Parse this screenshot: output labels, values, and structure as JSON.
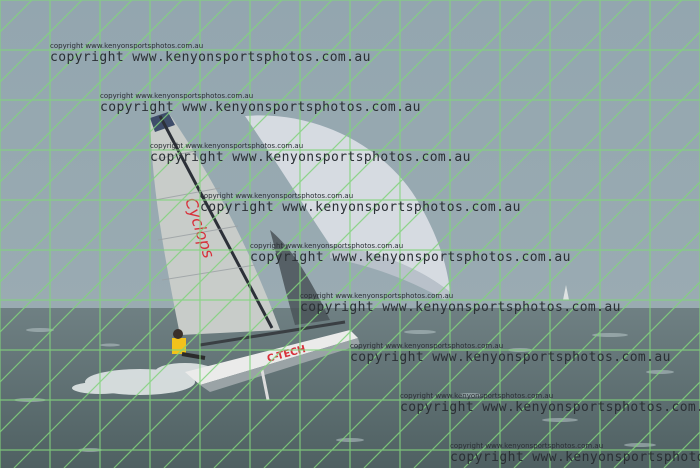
{
  "photo": {
    "subject": "Moth foiling dinghy with spinnaker on choppy water",
    "colors": {
      "sky": "#8fa3ac",
      "sea": "#5d6f72",
      "grid": "#7fd07a",
      "sail_main": "#c9ccc8",
      "spinnaker": "#d9dde3",
      "hull": "#e8e8e6",
      "hull_text": "#d8303a",
      "watermark": "#2a2f33"
    },
    "hull_label": "C-TECH",
    "sail_label": "Cyclops",
    "watermark": {
      "small_text": "copyright www.kenyonsportsphotos.com.au",
      "large_text": "copyright www.kenyonsportsphotos.com.au"
    }
  }
}
